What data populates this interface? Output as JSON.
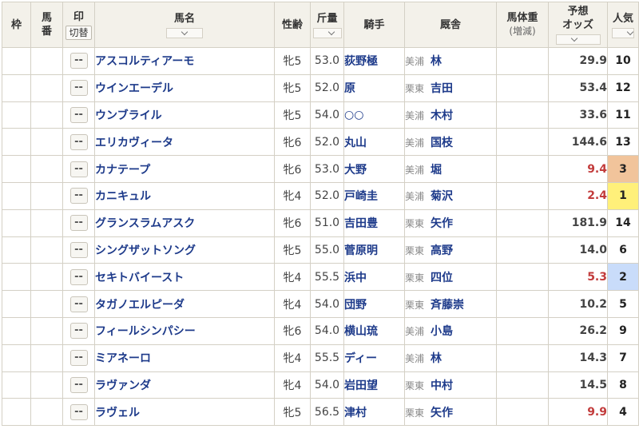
{
  "headers": {
    "waku": "枠",
    "umaban": "馬\n番",
    "mark": "印",
    "mark_toggle": "切替",
    "name": "馬名",
    "sexage": "性齢",
    "weight": "斤量",
    "jockey": "騎手",
    "stable": "厩舎",
    "body_weight": "馬体重",
    "body_weight_sub": "(増減)",
    "odds": "予想\nオッズ",
    "popularity": "人気"
  },
  "mark_label": "--",
  "rows": [
    {
      "name": "アスコルティアーモ",
      "sexage": "牝5",
      "weight": "53.0",
      "jockey": "荻野極",
      "region": "美浦",
      "trainer": "林",
      "odds": "29.9",
      "popularity": "10"
    },
    {
      "name": "ウインエーデル",
      "sexage": "牝5",
      "weight": "52.0",
      "jockey": "原",
      "region": "栗東",
      "trainer": "吉田",
      "odds": "53.4",
      "popularity": "12"
    },
    {
      "name": "ウンブライル",
      "sexage": "牝5",
      "weight": "54.0",
      "jockey": "○○",
      "region": "美浦",
      "trainer": "木村",
      "odds": "33.6",
      "popularity": "11"
    },
    {
      "name": "エリカヴィータ",
      "sexage": "牝6",
      "weight": "52.0",
      "jockey": "丸山",
      "region": "美浦",
      "trainer": "国枝",
      "odds": "144.6",
      "popularity": "13"
    },
    {
      "name": "カナテープ",
      "sexage": "牝6",
      "weight": "53.0",
      "jockey": "大野",
      "region": "美浦",
      "trainer": "堀",
      "odds": "9.4",
      "popularity": "3"
    },
    {
      "name": "カニキュル",
      "sexage": "牝4",
      "weight": "52.0",
      "jockey": "戸崎圭",
      "region": "美浦",
      "trainer": "菊沢",
      "odds": "2.4",
      "popularity": "1"
    },
    {
      "name": "グランスラムアスク",
      "sexage": "牝6",
      "weight": "51.0",
      "jockey": "吉田豊",
      "region": "栗東",
      "trainer": "矢作",
      "odds": "181.9",
      "popularity": "14"
    },
    {
      "name": "シングザットソング",
      "sexage": "牝5",
      "weight": "55.0",
      "jockey": "菅原明",
      "region": "栗東",
      "trainer": "高野",
      "odds": "14.0",
      "popularity": "6"
    },
    {
      "name": "セキトバイースト",
      "sexage": "牝4",
      "weight": "55.5",
      "jockey": "浜中",
      "region": "栗東",
      "trainer": "四位",
      "odds": "5.3",
      "popularity": "2"
    },
    {
      "name": "タガノエルピーダ",
      "sexage": "牝4",
      "weight": "54.0",
      "jockey": "団野",
      "region": "栗東",
      "trainer": "斉藤崇",
      "odds": "10.2",
      "popularity": "5"
    },
    {
      "name": "フィールシンパシー",
      "sexage": "牝6",
      "weight": "54.0",
      "jockey": "横山琉",
      "region": "美浦",
      "trainer": "小島",
      "odds": "26.2",
      "popularity": "9"
    },
    {
      "name": "ミアネーロ",
      "sexage": "牝4",
      "weight": "55.5",
      "jockey": "ディー",
      "region": "美浦",
      "trainer": "林",
      "odds": "14.3",
      "popularity": "7"
    },
    {
      "name": "ラヴァンダ",
      "sexage": "牝4",
      "weight": "54.0",
      "jockey": "岩田望",
      "region": "栗東",
      "trainer": "中村",
      "odds": "14.5",
      "popularity": "8"
    },
    {
      "name": "ラヴェル",
      "sexage": "牝5",
      "weight": "56.5",
      "jockey": "津村",
      "region": "栗東",
      "trainer": "矢作",
      "odds": "9.9",
      "popularity": "4"
    }
  ],
  "colors": {
    "pop1": "#fff07a",
    "pop2": "#c9dcfa",
    "pop3": "#f1c49b",
    "hot_odds": "#c23b3b",
    "link_blue": "#1d3a8a"
  }
}
